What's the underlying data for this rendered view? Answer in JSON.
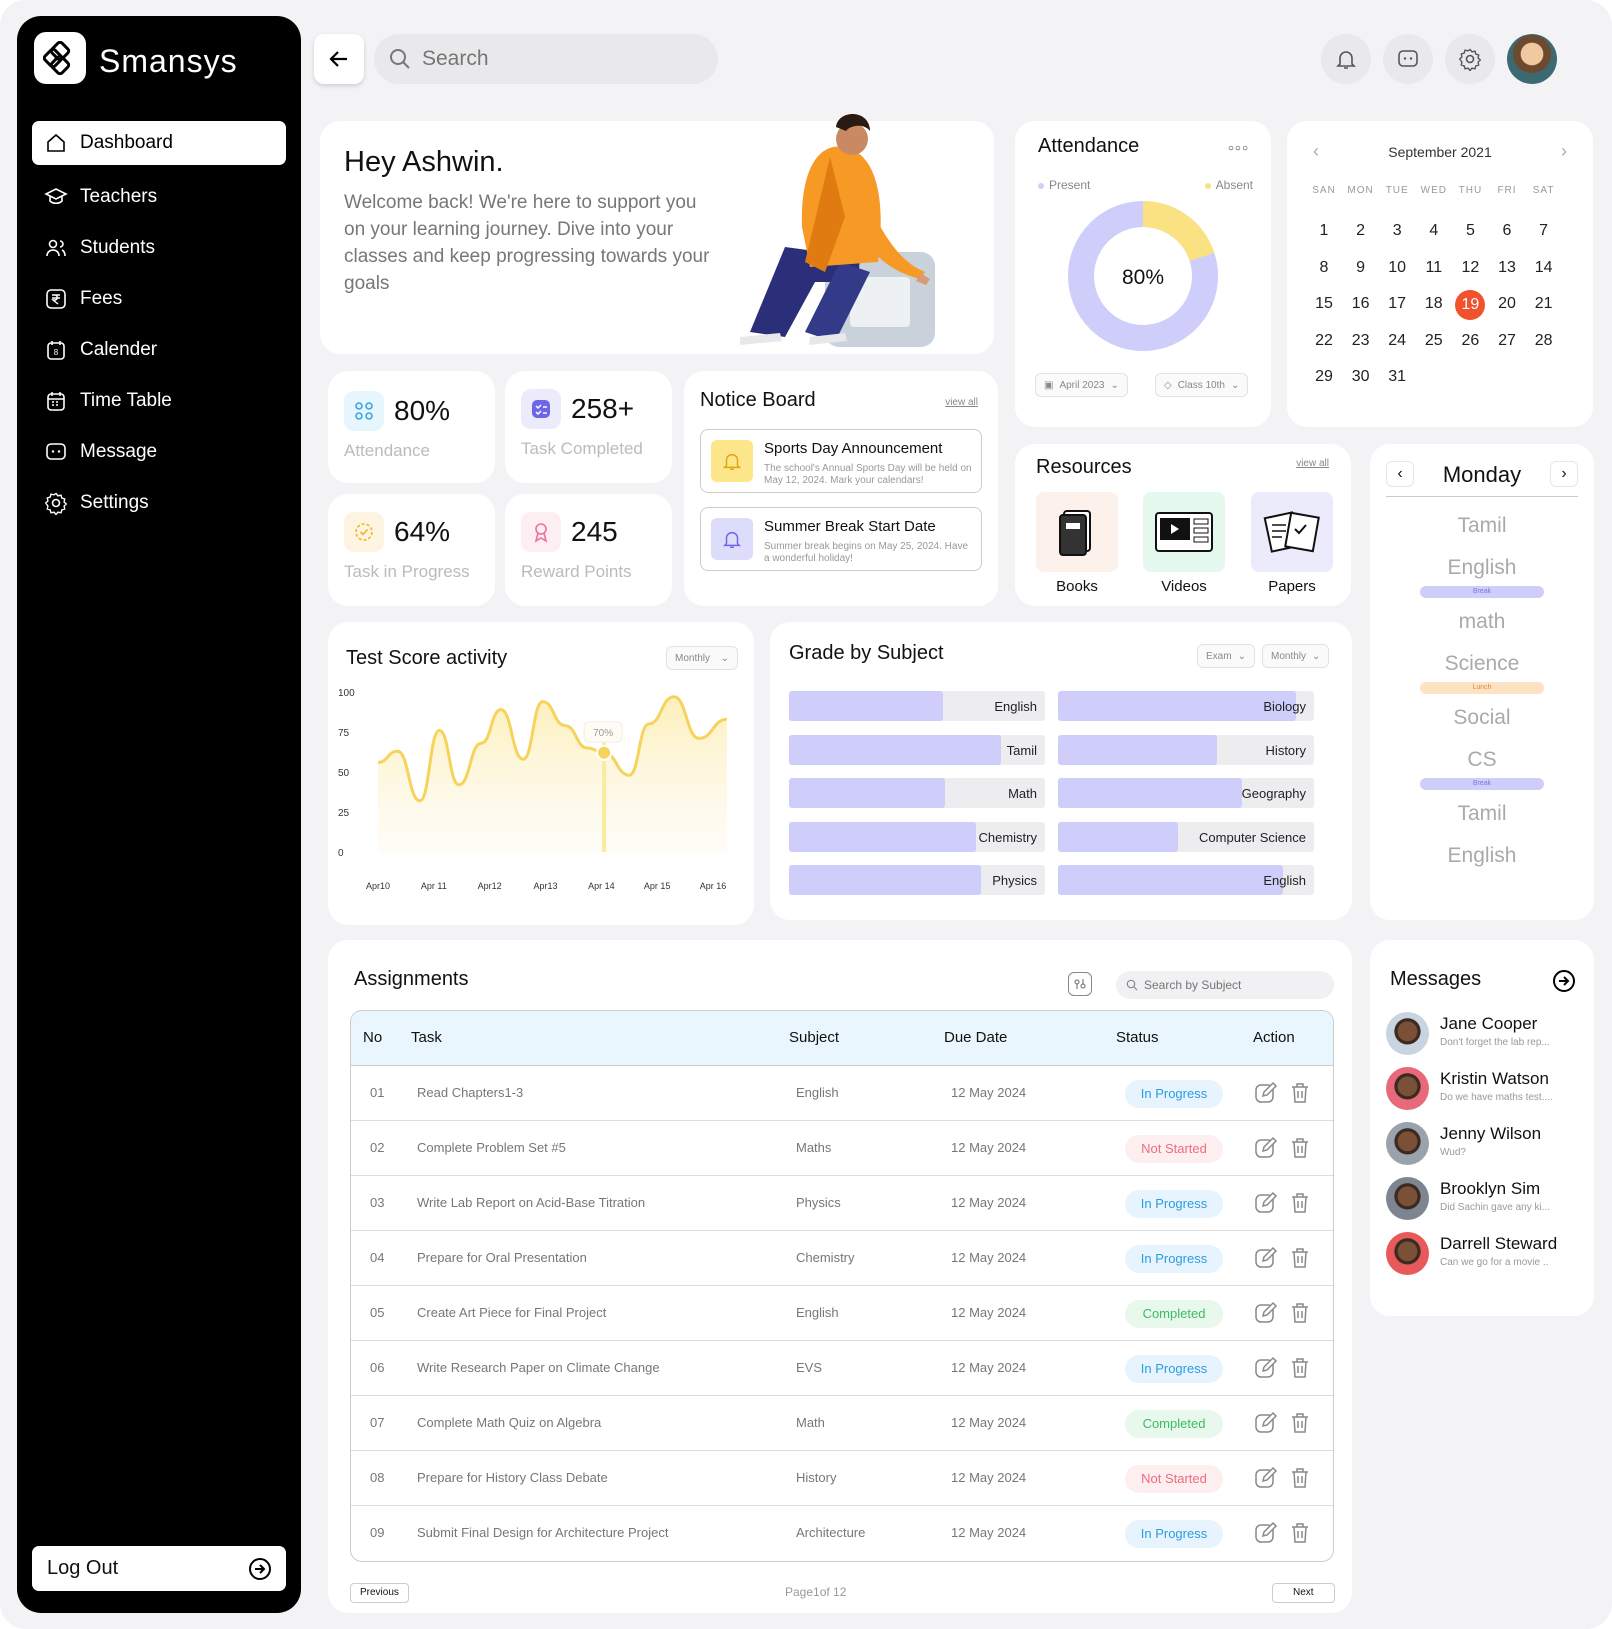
{
  "app": {
    "name": "Smansys"
  },
  "nav": {
    "items": [
      {
        "label": "Dashboard",
        "icon": "home-icon",
        "active": true
      },
      {
        "label": "Teachers",
        "icon": "graduation-cap-icon"
      },
      {
        "label": "Students",
        "icon": "users-icon"
      },
      {
        "label": "Fees",
        "icon": "rupee-icon"
      },
      {
        "label": "Calender",
        "icon": "calendar-icon"
      },
      {
        "label": "Time Table",
        "icon": "timetable-icon"
      },
      {
        "label": "Message",
        "icon": "message-icon"
      },
      {
        "label": "Settings",
        "icon": "gear-icon"
      }
    ],
    "logout": "Log Out"
  },
  "search": {
    "placeholder": "Search"
  },
  "welcome": {
    "title": "Hey Ashwin.",
    "text": "Welcome back! We're here to support you on your learning journey. Dive into your classes and keep progressing towards your goals"
  },
  "stats": [
    {
      "value": "80%",
      "label": "Attendance",
      "icon": "attendance-icon",
      "color": "#e7f5fd"
    },
    {
      "value": "258+",
      "label": "Task Completed",
      "icon": "task-icon",
      "color": "#ecebfc"
    },
    {
      "value": "64%",
      "label": "Task in Progress",
      "icon": "progress-icon",
      "color": "#fdf4e2"
    },
    {
      "value": "245",
      "label": "Reward Points",
      "icon": "reward-icon",
      "color": "#fdeef2"
    }
  ],
  "notice_board": {
    "title": "Notice Board",
    "view_all": "view all",
    "items": [
      {
        "title": "Sports Day Announcement",
        "desc": "The school's Annual Sports Day will be held on May 12, 2024. Mark your calendars!"
      },
      {
        "title": "Summer Break Start Date",
        "desc": "Summer break begins on May 25, 2024. Have a wonderful holiday!"
      }
    ]
  },
  "attendance": {
    "title": "Attendance",
    "legend_present": "Present",
    "legend_absent": "Absent",
    "percent": "80%",
    "present_fraction": 0.8,
    "filter_month": "April 2023",
    "filter_class": "Class 10th",
    "colors": {
      "present": "#cfcdfa",
      "absent": "#fae283"
    }
  },
  "calendar": {
    "month": "September 2021",
    "weekdays": [
      "SAN",
      "MON",
      "TUE",
      "WED",
      "THU",
      "FRI",
      "SAT"
    ],
    "days": [
      1,
      2,
      3,
      4,
      5,
      6,
      7,
      8,
      9,
      10,
      11,
      12,
      13,
      14,
      15,
      16,
      17,
      18,
      19,
      20,
      21,
      22,
      23,
      24,
      25,
      26,
      27,
      28,
      29,
      30,
      31
    ],
    "selected": 19,
    "selected_color": "#f0522d"
  },
  "resources": {
    "title": "Resources",
    "view_all": "view all",
    "items": [
      {
        "label": "Books",
        "icon": "book-icon",
        "bg": "#fdf1ec"
      },
      {
        "label": "Videos",
        "icon": "video-icon",
        "bg": "#e4f8ee"
      },
      {
        "label": "Papers",
        "icon": "papers-icon",
        "bg": "#ecebfc"
      }
    ]
  },
  "schedule": {
    "day": "Monday",
    "items": [
      {
        "type": "subject",
        "label": "Tamil"
      },
      {
        "type": "subject",
        "label": "English"
      },
      {
        "type": "break",
        "label": "Break"
      },
      {
        "type": "subject",
        "label": "math"
      },
      {
        "type": "subject",
        "label": "Science"
      },
      {
        "type": "lunch",
        "label": "Lunch"
      },
      {
        "type": "subject",
        "label": "Social"
      },
      {
        "type": "subject",
        "label": "CS"
      },
      {
        "type": "break",
        "label": "Break"
      },
      {
        "type": "subject",
        "label": "Tamil"
      },
      {
        "type": "subject",
        "label": "English"
      }
    ]
  },
  "test_score": {
    "title": "Test Score activity",
    "filter": "Monthly",
    "tooltip": "70%"
  },
  "chart_data": [
    {
      "type": "area",
      "title": "Test Score activity",
      "ylim": [
        0,
        100
      ],
      "yticks": [
        100,
        75,
        50,
        25,
        0
      ],
      "xticks": [
        "Apr10",
        "Apr 11",
        "Apr12",
        "Apr13",
        "Apr 14",
        "Apr 15",
        "Apr 16"
      ],
      "x": [
        0,
        0.35,
        0.75,
        1.1,
        1.45,
        1.85,
        2.2,
        2.6,
        2.95,
        3.35,
        3.75,
        4.05,
        4.5,
        4.85,
        5.3,
        5.75,
        6.25
      ],
      "y": [
        56,
        63,
        32,
        76,
        42,
        68,
        89,
        58,
        94,
        79,
        65,
        62,
        48,
        80,
        97,
        71,
        83
      ],
      "color": "#fbe38a",
      "highlight": {
        "x": 4.05,
        "label": "70%"
      }
    },
    {
      "type": "bar",
      "title": "Grade by Subject",
      "orientation": "horizontal",
      "filters": [
        "Exam",
        "Monthly"
      ],
      "xlim": [
        0,
        100
      ],
      "series": [
        {
          "categories": [
            "English",
            "Tamil",
            "Math",
            "Chemistry",
            "Physics"
          ],
          "values": [
            60,
            83,
            61,
            73,
            75
          ]
        },
        {
          "categories": [
            "Biology",
            "History",
            "Geography",
            "Computer Science",
            "English"
          ],
          "values": [
            93,
            62,
            72,
            47,
            88
          ]
        }
      ],
      "color": "#cfcdfa"
    }
  ],
  "assignments": {
    "title": "Assignments",
    "search_placeholder": "Search by Subject",
    "headers": [
      "No",
      "Task",
      "Subject",
      "Due Date",
      "Status",
      "Action"
    ],
    "rows": [
      {
        "no": "01",
        "task": "Read Chapters1-3",
        "subject": "English",
        "due": "12 May 2024",
        "status": "In Progress",
        "kind": "ip"
      },
      {
        "no": "02",
        "task": "Complete Problem Set #5",
        "subject": "Maths",
        "due": "12 May 2024",
        "status": "Not Started",
        "kind": "ns"
      },
      {
        "no": "03",
        "task": "Write Lab Report on Acid-Base Titration",
        "subject": "Physics",
        "due": "12 May 2024",
        "status": "In Progress",
        "kind": "ip"
      },
      {
        "no": "04",
        "task": "Prepare for Oral Presentation",
        "subject": "Chemistry",
        "due": "12 May 2024",
        "status": "In Progress",
        "kind": "ip"
      },
      {
        "no": "05",
        "task": "Create Art Piece for Final Project",
        "subject": "English",
        "due": "12 May 2024",
        "status": "Completed",
        "kind": "co"
      },
      {
        "no": "06",
        "task": "Write Research Paper on Climate Change",
        "subject": "EVS",
        "due": "12 May 2024",
        "status": "In Progress",
        "kind": "ip"
      },
      {
        "no": "07",
        "task": "Complete Math Quiz on Algebra",
        "subject": "Math",
        "due": "12 May 2024",
        "status": "Completed",
        "kind": "co"
      },
      {
        "no": "08",
        "task": "Prepare for History Class Debate",
        "subject": "History",
        "due": "12 May 2024",
        "status": "Not Started",
        "kind": "ns"
      },
      {
        "no": "09",
        "task": "Submit Final Design for Architecture Project",
        "subject": "Architecture",
        "due": "12 May 2024",
        "status": "In Progress",
        "kind": "ip"
      }
    ],
    "pagination": {
      "prev": "Previous",
      "info": "Page1of 12",
      "next": "Next"
    }
  },
  "messages": {
    "title": "Messages",
    "items": [
      {
        "name": "Jane Cooper",
        "preview": "Don't forget the lab rep...",
        "color": "#c8d4e0"
      },
      {
        "name": "Kristin Watson",
        "preview": "Do we have maths test....",
        "color": "#e86a7a"
      },
      {
        "name": "Jenny Wilson",
        "preview": "Wud?",
        "color": "#9aa3ab"
      },
      {
        "name": "Brooklyn Sim",
        "preview": "Did Sachin gave any ki...",
        "color": "#7d8590"
      },
      {
        "name": "Darrell Steward",
        "preview": "Can we go for a movie ..",
        "color": "#e85a5a"
      }
    ]
  }
}
